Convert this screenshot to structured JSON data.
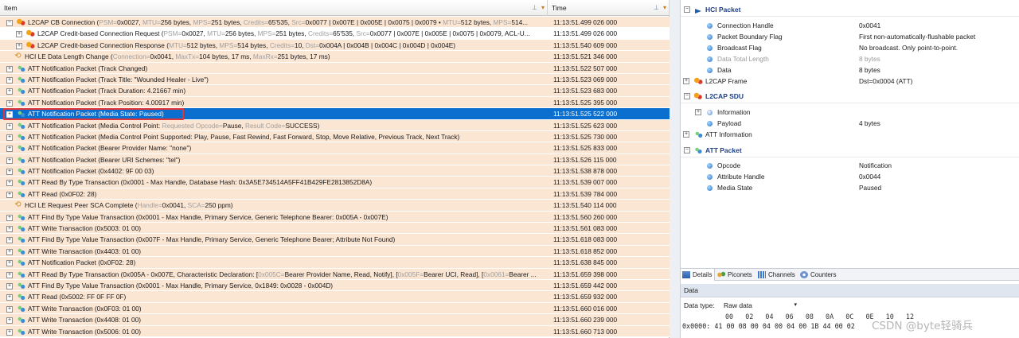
{
  "grid": {
    "col_item": "Item",
    "col_time": "Time",
    "rows": [
      {
        "exp": "⊟",
        "indent": 0,
        "icon": "l2cap",
        "parts": [
          {
            "t": "L2CAP CB Connection ("
          },
          {
            "t": "PSM=",
            "d": true
          },
          {
            "t": "0x0027, "
          },
          {
            "t": "MTU=",
            "d": true
          },
          {
            "t": "256 bytes, "
          },
          {
            "t": "MPS=",
            "d": true
          },
          {
            "t": "251 bytes, "
          },
          {
            "t": "Credits=",
            "d": true
          },
          {
            "t": "65'535, "
          },
          {
            "t": "Src=",
            "d": true
          },
          {
            "t": "0x0077 | 0x007E | 0x005E | 0x0075 | 0x0079 • "
          },
          {
            "t": "MTU=",
            "d": true
          },
          {
            "t": "512 bytes, "
          },
          {
            "t": "MPS=",
            "d": true
          },
          {
            "t": "514..."
          }
        ],
        "time": "11:13:51.499 026 000",
        "bg": "o"
      },
      {
        "exp": "⊞",
        "indent": 1,
        "icon": "l2cap",
        "parts": [
          {
            "t": "L2CAP Credit-based Connection Request ("
          },
          {
            "t": "PSM=",
            "d": true
          },
          {
            "t": "0x0027, "
          },
          {
            "t": "MTU=",
            "d": true
          },
          {
            "t": "256 bytes, "
          },
          {
            "t": "MPS=",
            "d": true
          },
          {
            "t": "251 bytes, "
          },
          {
            "t": "Credits=",
            "d": true
          },
          {
            "t": "65'535, "
          },
          {
            "t": "Src=",
            "d": true
          },
          {
            "t": "0x0077 | 0x007E | 0x005E | 0x0075 | 0x0079, ACL-U..."
          }
        ],
        "time": "11:13:51.499 026 000",
        "bg": "w"
      },
      {
        "exp": "⊞",
        "indent": 1,
        "icon": "l2cap",
        "parts": [
          {
            "t": "L2CAP Credit-based Connection Response ("
          },
          {
            "t": "MTU=",
            "d": true
          },
          {
            "t": "512 bytes, "
          },
          {
            "t": "MPS=",
            "d": true
          },
          {
            "t": "514 bytes, "
          },
          {
            "t": "Credits=",
            "d": true
          },
          {
            "t": "10, "
          },
          {
            "t": "Dst=",
            "d": true
          },
          {
            "t": "0x004A | 0x004B | 0x004C | 0x004D | 0x004E)"
          }
        ],
        "time": "11:13:51.540 609 000",
        "bg": "o"
      },
      {
        "exp": "",
        "indent": 0,
        "icon": "hci",
        "parts": [
          {
            "t": "HCI LE Data Length Change ("
          },
          {
            "t": "Connection=",
            "d": true
          },
          {
            "t": "0x0041, "
          },
          {
            "t": "MaxTx=",
            "d": true
          },
          {
            "t": "104 bytes, 17 ms, "
          },
          {
            "t": "MaxRx=",
            "d": true
          },
          {
            "t": "251 bytes, 17 ms)"
          }
        ],
        "time": "11:13:51.521 346 000",
        "bg": "o"
      },
      {
        "exp": "⊞",
        "indent": 0,
        "icon": "att",
        "parts": [
          {
            "t": "ATT Notification Packet (Track Changed)"
          }
        ],
        "time": "11:13:51.522 507 000",
        "bg": "o"
      },
      {
        "exp": "⊞",
        "indent": 0,
        "icon": "att",
        "parts": [
          {
            "t": "ATT Notification Packet (Track Title: \"Wounded Healer - Live\")"
          }
        ],
        "time": "11:13:51.523 069 000",
        "bg": "o"
      },
      {
        "exp": "⊞",
        "indent": 0,
        "icon": "att",
        "parts": [
          {
            "t": "ATT Notification Packet (Track Duration: 4.21667 min)"
          }
        ],
        "time": "11:13:51.523 683 000",
        "bg": "o"
      },
      {
        "exp": "⊞",
        "indent": 0,
        "icon": "att",
        "parts": [
          {
            "t": "ATT Notification Packet (Track Position: 4.00917 min)"
          }
        ],
        "time": "11:13:51.525 395 000",
        "bg": "o"
      },
      {
        "exp": "⊞",
        "indent": 0,
        "icon": "att",
        "parts": [
          {
            "t": "ATT Notification Packet (Media State: Paused)"
          }
        ],
        "time": "11:13:51.525 522 000",
        "bg": "sel"
      },
      {
        "exp": "⊞",
        "indent": 0,
        "icon": "att",
        "parts": [
          {
            "t": "ATT Notification Packet (Media Control Point: "
          },
          {
            "t": "Requested Opcode=",
            "d": true
          },
          {
            "t": "Pause, "
          },
          {
            "t": "Result Code=",
            "d": true
          },
          {
            "t": "SUCCESS)"
          }
        ],
        "time": "11:13:51.525 623 000",
        "bg": "o"
      },
      {
        "exp": "⊞",
        "indent": 0,
        "icon": "att",
        "parts": [
          {
            "t": "ATT Notification Packet (Media Control Point Supported: Play, Pause, Fast Rewind, Fast Forward, Stop, Move Relative, Previous Track, Next Track)"
          }
        ],
        "time": "11:13:51.525 730 000",
        "bg": "o"
      },
      {
        "exp": "⊞",
        "indent": 0,
        "icon": "att",
        "parts": [
          {
            "t": "ATT Notification Packet (Bearer Provider Name: \"none\")"
          }
        ],
        "time": "11:13:51.525 833 000",
        "bg": "o"
      },
      {
        "exp": "⊞",
        "indent": 0,
        "icon": "att",
        "parts": [
          {
            "t": "ATT Notification Packet (Bearer URI Schemes: \"tel\")"
          }
        ],
        "time": "11:13:51.526 115 000",
        "bg": "o"
      },
      {
        "exp": "⊞",
        "indent": 0,
        "icon": "att",
        "parts": [
          {
            "t": "ATT Notification Packet (0x4402: 9F 00 03)"
          }
        ],
        "time": "11:13:51.538 878 000",
        "bg": "o"
      },
      {
        "exp": "⊞",
        "indent": 0,
        "icon": "att",
        "parts": [
          {
            "t": "ATT Read By Type Transaction (0x0001 - Max Handle, Database Hash: 0x3A5E734514A5FF41B429FE2813852D8A)"
          }
        ],
        "time": "11:13:51.539 007 000",
        "bg": "o"
      },
      {
        "exp": "⊞",
        "indent": 0,
        "icon": "att",
        "parts": [
          {
            "t": "ATT Read (0x0F02: 28)"
          }
        ],
        "time": "11:13:51.539 784 000",
        "bg": "o"
      },
      {
        "exp": "",
        "indent": 0,
        "icon": "hci",
        "parts": [
          {
            "t": "HCI LE Request Peer SCA Complete ("
          },
          {
            "t": "Handle=",
            "d": true
          },
          {
            "t": "0x0041, "
          },
          {
            "t": "SCA=",
            "d": true
          },
          {
            "t": "250 ppm)"
          }
        ],
        "time": "11:13:51.540 114 000",
        "bg": "o"
      },
      {
        "exp": "⊞",
        "indent": 0,
        "icon": "att",
        "parts": [
          {
            "t": "ATT Find By Type Value Transaction (0x0001 - Max Handle, Primary Service, Generic Telephone Bearer: 0x005A - 0x007E)"
          }
        ],
        "time": "11:13:51.560 260 000",
        "bg": "o"
      },
      {
        "exp": "⊞",
        "indent": 0,
        "icon": "att",
        "parts": [
          {
            "t": "ATT Write Transaction (0x5003: 01 00)"
          }
        ],
        "time": "11:13:51.561 083 000",
        "bg": "o"
      },
      {
        "exp": "⊞",
        "indent": 0,
        "icon": "att",
        "parts": [
          {
            "t": "ATT Find By Type Value Transaction (0x007F - Max Handle, Primary Service, Generic Telephone Bearer; Attribute Not Found)"
          }
        ],
        "time": "11:13:51.618 083 000",
        "bg": "o"
      },
      {
        "exp": "⊞",
        "indent": 0,
        "icon": "att",
        "parts": [
          {
            "t": "ATT Write Transaction (0x4403: 01 00)"
          }
        ],
        "time": "11:13:51.618 852 000",
        "bg": "o"
      },
      {
        "exp": "⊞",
        "indent": 0,
        "icon": "att",
        "parts": [
          {
            "t": "ATT Notification Packet (0x0F02: 28)"
          }
        ],
        "time": "11:13:51.638 845 000",
        "bg": "o"
      },
      {
        "exp": "⊞",
        "indent": 0,
        "icon": "att",
        "parts": [
          {
            "t": "ATT Read By Type Transaction (0x005A - 0x007E, Characteristic Declaration: ["
          },
          {
            "t": "0x005C=",
            "d": true
          },
          {
            "t": "Bearer Provider Name, Read, Notify], ["
          },
          {
            "t": "0x005F=",
            "d": true
          },
          {
            "t": "Bearer UCI, Read], ["
          },
          {
            "t": "0x0061=",
            "d": true
          },
          {
            "t": "Bearer ..."
          }
        ],
        "time": "11:13:51.659 398 000",
        "bg": "o"
      },
      {
        "exp": "⊞",
        "indent": 0,
        "icon": "att",
        "parts": [
          {
            "t": "ATT Find By Type Value Transaction (0x0001 - Max Handle, Primary Service, 0x1849: 0x0028 - 0x004D)"
          }
        ],
        "time": "11:13:51.659 442 000",
        "bg": "o"
      },
      {
        "exp": "⊞",
        "indent": 0,
        "icon": "att",
        "parts": [
          {
            "t": "ATT Read (0x5002: FF 0F FF 0F)"
          }
        ],
        "time": "11:13:51.659 932 000",
        "bg": "o"
      },
      {
        "exp": "⊞",
        "indent": 0,
        "icon": "att",
        "parts": [
          {
            "t": "ATT Write Transaction (0x0F03: 01 00)"
          }
        ],
        "time": "11:13:51.660 016 000",
        "bg": "o"
      },
      {
        "exp": "⊞",
        "indent": 0,
        "icon": "att",
        "parts": [
          {
            "t": "ATT Write Transaction (0x4408: 01 00)"
          }
        ],
        "time": "11:13:51.660 239 000",
        "bg": "o"
      },
      {
        "exp": "⊞",
        "indent": 0,
        "icon": "att",
        "parts": [
          {
            "t": "ATT Write Transaction (0x5006: 01 00)"
          }
        ],
        "time": "11:13:51.660 713 000",
        "bg": "o"
      }
    ]
  },
  "details": {
    "hci_title": "HCI Packet",
    "hci_fields": [
      {
        "k": "Connection Handle",
        "v": "0x0041",
        "gray": false
      },
      {
        "k": "Packet Boundary Flag",
        "v": "First non-automatically-flushable packet",
        "gray": false
      },
      {
        "k": "Broadcast Flag",
        "v": "No broadcast. Only point-to-point.",
        "gray": false
      },
      {
        "k": "Data Total Length",
        "v": "8 bytes",
        "gray": true
      },
      {
        "k": "Data",
        "v": "8 bytes",
        "gray": false
      }
    ],
    "l2cap_frame_label": "L2CAP Frame",
    "l2cap_frame_value": "Dst=0x0004 (ATT)",
    "sdu_title": "L2CAP SDU",
    "sdu_info": "Information",
    "sdu_payload_label": "Payload",
    "sdu_payload_value": "4 bytes",
    "att_info": "ATT Information",
    "att_title": "ATT Packet",
    "att_fields": [
      {
        "k": "Opcode",
        "v": "Notification"
      },
      {
        "k": "Attribute Handle",
        "v": "0x0044"
      },
      {
        "k": "Media State",
        "v": "Paused"
      }
    ]
  },
  "tabs": [
    "Details",
    "Piconets",
    "Channels",
    "Counters"
  ],
  "data_panel": {
    "title": "Data",
    "type_label": "Data type:",
    "type_value": "Raw data",
    "hex_header": "00   02   04   06   08   0A   0C   0E   10   12",
    "hex_offset": "0x0000:",
    "hex_bytes": "41 00 08 00 04 00 04 00 1B 44 00 02"
  },
  "watermark": "CSDN @byte轻骑兵"
}
